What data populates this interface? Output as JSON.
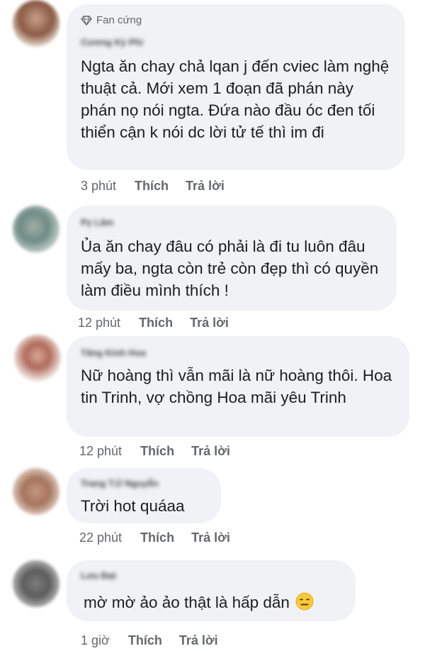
{
  "comments": [
    {
      "badge": "Fan cứng",
      "author": "Cương Kỳ Phi",
      "text": "Ngta ăn chay chả lqan j đến cviec làm nghệ thuật cả. Mới xem 1 đoạn đã phán này phán nọ nói ngta. Đứa nào đầu óc đen tối thiển cận k nói dc lời tử tế thì im đi",
      "time": "3 phút",
      "like": "Thích",
      "reply": "Trả lời"
    },
    {
      "author": "Py Lâm",
      "text": "Ủa ăn chay đâu có phải là đi tu luôn đâu mấy ba, ngta còn trẻ còn đẹp thì có quyền làm điều mình thích !",
      "time": "12 phút",
      "like": "Thích",
      "reply": "Trả lời"
    },
    {
      "author": "Tăng Kinh Hoa",
      "text": "Nữ hoàng thì vẫn mãi là nữ hoàng thôi. Hoa tin Trinh, vợ chồng Hoa mãi yêu Trinh",
      "time": "12 phút",
      "like": "Thích",
      "reply": "Trả lời"
    },
    {
      "author": "Trang T.Ú Nguyễn",
      "text": "Trời hot quáaa",
      "time": "22 phút",
      "like": "Thích",
      "reply": "Trả lời"
    },
    {
      "author": "Lưu Đạt",
      "text": "mờ mờ ảo ảo thật là hấp dẫn",
      "emoji": "expressionless-face-emoji",
      "time": "1 giờ",
      "like": "Thích",
      "reply": "Trả lời"
    }
  ],
  "colors": {
    "bubble": "#f0f2f5",
    "meta": "#65676b",
    "text": "#1c1e21"
  }
}
